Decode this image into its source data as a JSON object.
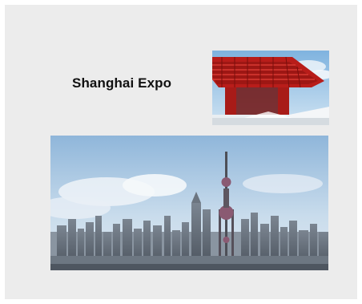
{
  "card": {
    "title": "Shanghai Expo"
  },
  "images": {
    "expo_pavilion": {
      "icon": "china-pavilion-image",
      "sky_color": "#9fc6e6",
      "building_color": "#c0221f"
    },
    "skyline": {
      "icon": "shanghai-skyline-image",
      "sky_color": "#a9c7e2",
      "building_color": "#5b6470"
    }
  }
}
